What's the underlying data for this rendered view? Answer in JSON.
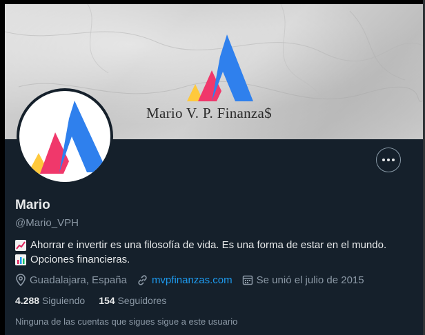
{
  "banner": {
    "brand_text": "Mario V. P. Finanza$"
  },
  "profile": {
    "name": "Mario",
    "handle": "@Mario_VPH",
    "bio_line1": "Ahorrar e invertir es una filosofía de vida. Es una forma de estar en el mundo.",
    "bio_line2": "Opciones financieras.",
    "location": "Guadalajara, España",
    "website": "mvpfinanzas.com",
    "joined": "Se unió el julio de 2015"
  },
  "stats": {
    "following_count": "4.288",
    "following_label": "Siguiendo",
    "followers_count": "154",
    "followers_label": "Seguidores"
  },
  "note": "Ninguna de las cuentas que sigues sigue a este usuario",
  "colors": {
    "background": "#15202b",
    "link": "#1d9bf0",
    "muted": "#8b98a5",
    "logo_blue": "#2f80ed",
    "logo_pink": "#f0386b",
    "logo_yellow": "#ffc93c"
  },
  "icons": {
    "bio_line1": "chart-increasing-icon",
    "bio_line2": "bar-chart-icon",
    "location": "location-pin-icon",
    "website": "link-icon",
    "joined": "calendar-icon",
    "more": "more-options-icon"
  }
}
